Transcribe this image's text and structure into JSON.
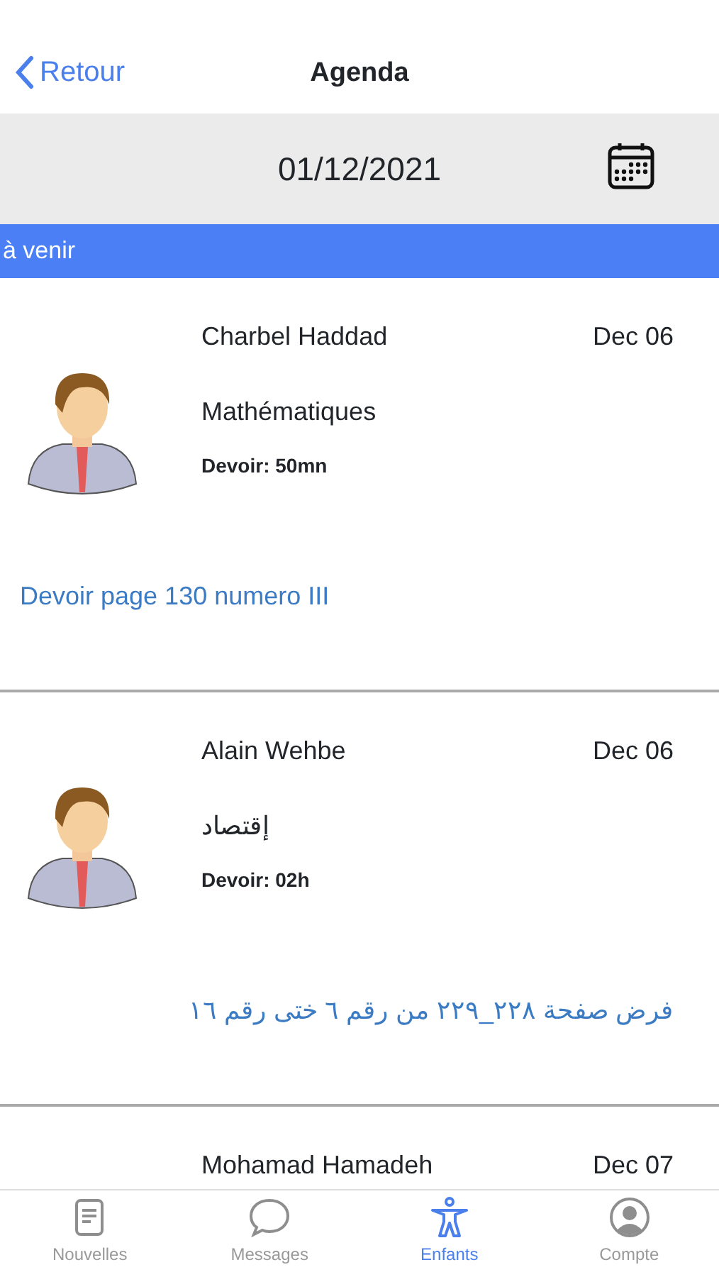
{
  "nav": {
    "back": "Retour",
    "title": "Agenda"
  },
  "date_bar": {
    "date": "01/12/2021"
  },
  "section": "à venir",
  "entries": [
    {
      "teacher": "Charbel Haddad",
      "date": "Dec 06",
      "subject": "Mathématiques",
      "duration": "Devoir: 50mn",
      "note": "Devoir page 130 numero III"
    },
    {
      "teacher": "Alain Wehbe",
      "date": "Dec 06",
      "subject": "إقتصاد",
      "duration": "Devoir: 02h",
      "note": "فرض صفحة ٢٢٨_٢٢٩ من رقم ٦ ختى رقم ١٦"
    },
    {
      "teacher": "Mohamad Hamadeh",
      "date": "Dec 07"
    }
  ],
  "tabs": [
    {
      "label": "Nouvelles",
      "kind": "news",
      "selected": false
    },
    {
      "label": "Messages",
      "kind": "chat",
      "selected": false
    },
    {
      "label": "Enfants",
      "kind": "person",
      "selected": true
    },
    {
      "label": "Compte",
      "kind": "account",
      "selected": false
    }
  ]
}
